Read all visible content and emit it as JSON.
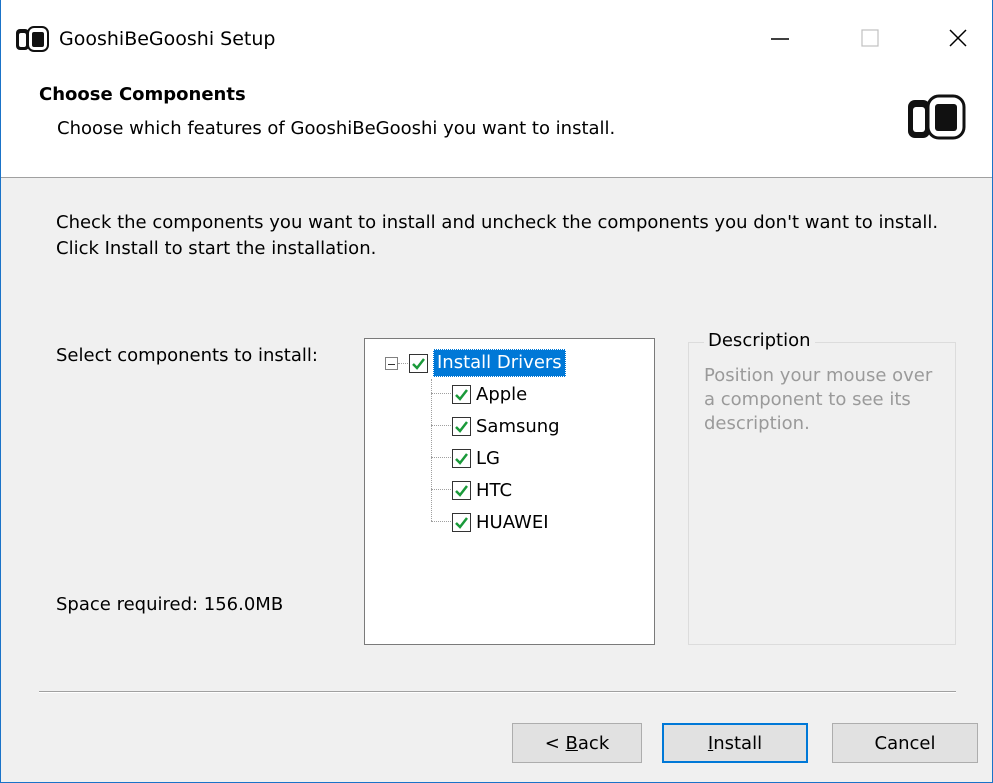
{
  "window": {
    "title": "GooshiBeGooshi Setup",
    "min_glyph": "—",
    "max_glyph": "☐",
    "close_glyph": "✕"
  },
  "header": {
    "title": "Choose Components",
    "subtitle": "Choose which features of GooshiBeGooshi you want to install."
  },
  "body": {
    "instructions": "Check the components you want to install and uncheck the components you don't want to install. Click Install to start the installation.",
    "select_label": "Select components to install:",
    "space_required": "Space required: 156.0MB"
  },
  "tree": {
    "root": {
      "label": "Install Drivers",
      "checked": true,
      "expanded": true,
      "selected": true
    },
    "children": [
      {
        "label": "Apple",
        "checked": true
      },
      {
        "label": "Samsung",
        "checked": true
      },
      {
        "label": "LG",
        "checked": true
      },
      {
        "label": "HTC",
        "checked": true
      },
      {
        "label": "HUAWEI",
        "checked": true
      }
    ]
  },
  "description": {
    "legend": "Description",
    "text": "Position your mouse over a component to see its description."
  },
  "buttons": {
    "back_prefix": "< ",
    "back_key": "B",
    "back_rest": "ack",
    "install_key": "I",
    "install_rest": "nstall",
    "cancel": "Cancel"
  },
  "colors": {
    "accent": "#0078d7",
    "check": "#1a9a3a",
    "window_border": "#1a73c8"
  }
}
